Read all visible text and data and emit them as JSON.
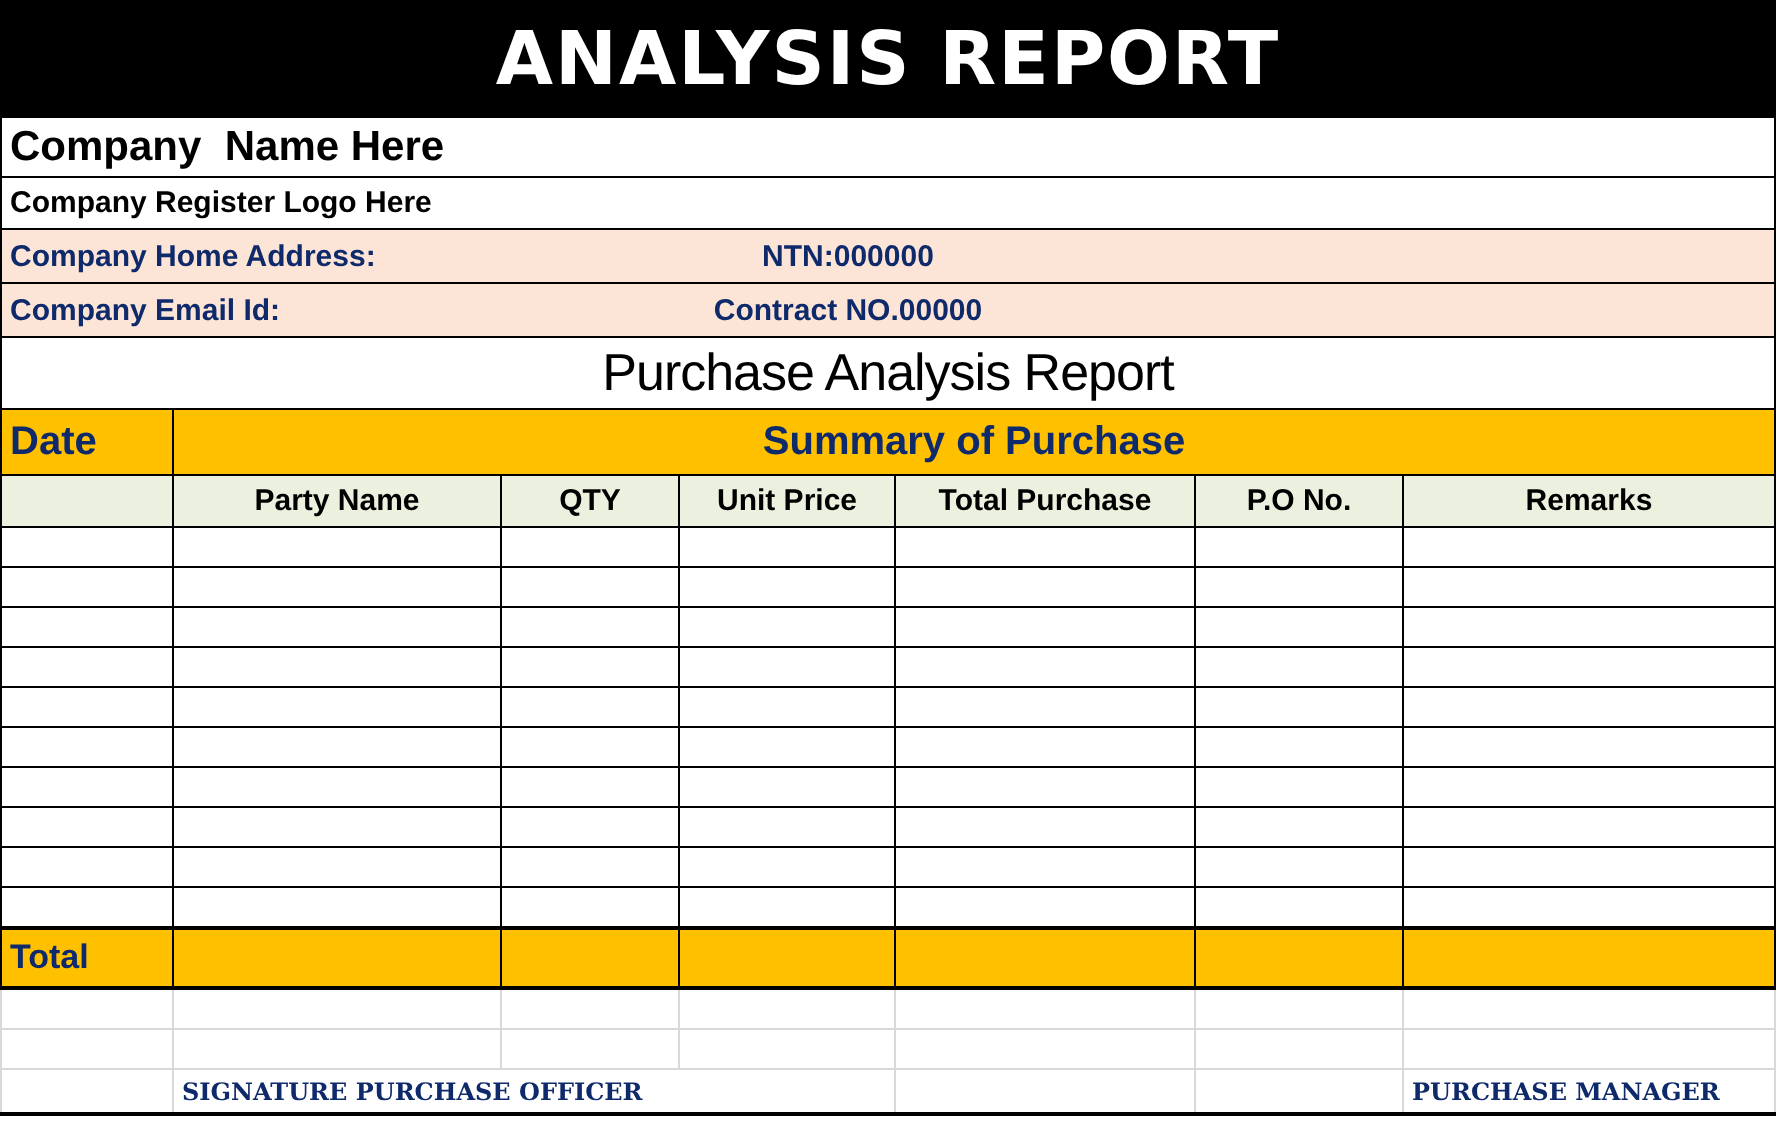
{
  "title": "ANALYSIS REPORT",
  "company_name": "Company  Name Here",
  "logo_line": "Company Register Logo Here",
  "address": {
    "label": "Company Home Address:",
    "value": "NTN:000000"
  },
  "email": {
    "label": "Company Email Id:",
    "value": "Contract NO.00000"
  },
  "report_title": "Purchase Analysis Report",
  "date_label": "Date",
  "summary_label": "Summary of Purchase",
  "columns": [
    "Party Name",
    "QTY",
    "Unit Price",
    "Total Purchase",
    "P.O No.",
    "Remarks"
  ],
  "total_label": "Total",
  "signatures": {
    "officer": "SIGNATURE PURCHASE OFFICER",
    "manager": "PURCHASE MANAGER"
  }
}
